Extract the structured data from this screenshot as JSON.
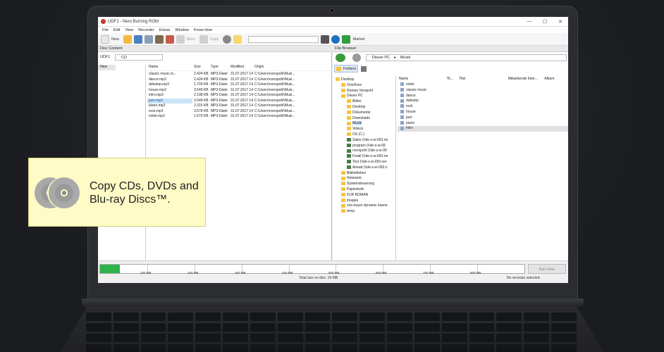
{
  "window": {
    "title": "UDF1 - Nero Burning ROM",
    "minimize": "—",
    "maximize": "☐",
    "close": "✕"
  },
  "menu": [
    "File",
    "Edit",
    "View",
    "Recorder",
    "Extras",
    "Window",
    "Know How"
  ],
  "toolbar": {
    "new_label": "New",
    "burn_label": "Burn",
    "copy_label": "Copy",
    "market_label": "Market"
  },
  "disc_content": {
    "header": "Disc Content",
    "disc_type": "UDF1",
    "dropdown": "CD",
    "tree_root": "New",
    "columns": [
      "Name",
      "Size",
      "Type",
      "Modified",
      "Origin"
    ],
    "files": [
      {
        "name": "classic music.m...",
        "size": "2.424 KB",
        "type": "MP3-Datei",
        "modified": "31.07.2017 14:...",
        "origin": "C:\\Users\\rverspohl\\Musi..."
      },
      {
        "name": "dance.mp3",
        "size": "2.424 KB",
        "type": "MP3-Datei",
        "modified": "31.07.2017 14:...",
        "origin": "C:\\Users\\rverspohl\\Musi..."
      },
      {
        "name": "dubstep.mp3",
        "size": "1.709 KB",
        "type": "MP3-Datei",
        "modified": "31.07.2017 14:...",
        "origin": "C:\\Users\\rverspohl\\Musi..."
      },
      {
        "name": "house.mp3",
        "size": "3.549 KB",
        "type": "MP3-Datei",
        "modified": "31.07.2017 14:...",
        "origin": "C:\\Users\\rverspohl\\Musi..."
      },
      {
        "name": "intro.mp3",
        "size": "2.198 KB",
        "type": "MP3-Datei",
        "modified": "31.07.2017 14:...",
        "origin": "C:\\Users\\rverspohl\\Musi..."
      },
      {
        "name": "jazz.mp3",
        "size": "3.549 KB",
        "type": "MP3-Datei",
        "modified": "31.07.2017 14:...",
        "origin": "C:\\Users\\rverspohl\\Musi..."
      },
      {
        "name": "piano.mp3",
        "size": "2.315 KB",
        "type": "MP3-Datei",
        "modified": "31.07.2017 14:...",
        "origin": "C:\\Users\\rverspohl\\Musi..."
      },
      {
        "name": "rock.mp3",
        "size": "3.578 KB",
        "type": "MP3-Datei",
        "modified": "31.07.2017 14:...",
        "origin": "C:\\Users\\rverspohl\\Musi..."
      },
      {
        "name": "violet.mp3",
        "size": "1.670 KB",
        "type": "MP3-Datei",
        "modified": "31.07.2017 14:...",
        "origin": "C:\\Users\\rverspohl\\Musi..."
      }
    ],
    "selected_file": "jazz.mp3"
  },
  "file_browser": {
    "header": "File Browser",
    "breadcrumb": [
      "Dieser PC",
      "Musik"
    ],
    "folders_label": "Folders",
    "tree": [
      "Desktop",
      "OneDrive",
      "Roman Verspohl",
      "Dieser PC",
      "Bilder",
      "Desktop",
      "Dokumente",
      "Downloads",
      "Musik",
      "Videos",
      "OS (C:)",
      "Sales (\\\\de-s-w-093.ne",
      "program (\\\\de-s-w-09",
      "rverspohl (\\\\de-s-w-09",
      "Forall (\\\\de-s-w-093.ne",
      "Test (\\\\de-s-w-093.ner",
      "Ahead (\\\\de-s-w-093.n",
      "Bibliotheken",
      "Netzwerk",
      "Systemsteuerung",
      "Papierkorb",
      "FÜR ROMAN",
      "images",
      "non-buyer dynamic banne",
      "temp"
    ],
    "selected_folder": "Musik",
    "list_columns": [
      "Name",
      "Tit...",
      "Titel",
      "Mitwirkende Inter...",
      "Album"
    ],
    "list_items": [
      "violet",
      "classic music",
      "dance",
      "dubstep",
      "rock",
      "house",
      "jazz",
      "piano",
      "intro"
    ],
    "selected_item": "intro"
  },
  "capacity": {
    "ticks": [
      "100 MB",
      "200 MB",
      "300 MB",
      "400 MB",
      "500 MB",
      "600 MB",
      "700 MB",
      "800 MB"
    ],
    "used_fraction": 0.027,
    "burn_now": "Burn Now",
    "total_size": "Total size on disc: 24 MB",
    "recorder_status": "No recorder selected."
  },
  "callout": {
    "text": "Copy CDs, DVDs and Blu-ray Discs™."
  },
  "colors": {
    "capacity_fill": "#2db34a",
    "callout_bg": "#fffbc6",
    "selection": "#cce4f7"
  }
}
